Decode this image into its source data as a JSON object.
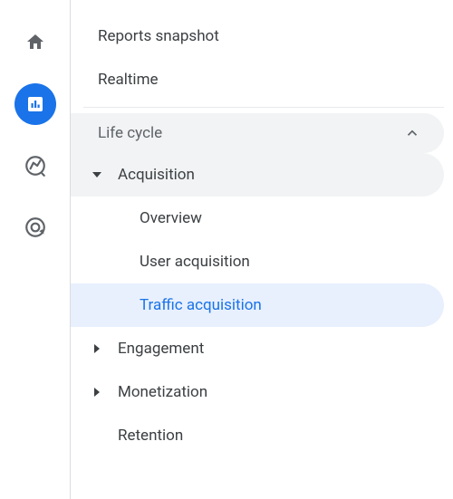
{
  "rail": {
    "items": [
      {
        "name": "home-icon",
        "active": false
      },
      {
        "name": "reports-icon",
        "active": true
      },
      {
        "name": "explore-icon",
        "active": false
      },
      {
        "name": "advertising-icon",
        "active": false
      }
    ]
  },
  "nav": {
    "top": [
      {
        "label": "Reports snapshot"
      },
      {
        "label": "Realtime"
      }
    ],
    "section": {
      "label": "Life cycle",
      "expanded": true
    },
    "groups": [
      {
        "label": "Acquisition",
        "expanded": true,
        "items": [
          {
            "label": "Overview",
            "selected": false
          },
          {
            "label": "User acquisition",
            "selected": false
          },
          {
            "label": "Traffic acquisition",
            "selected": true
          }
        ]
      },
      {
        "label": "Engagement",
        "expanded": false,
        "items": []
      },
      {
        "label": "Monetization",
        "expanded": false,
        "items": []
      },
      {
        "label": "Retention",
        "expanded": false,
        "leaf": true,
        "items": []
      }
    ]
  },
  "colors": {
    "accent": "#1a73e8",
    "selected_bg": "#e8f0fe",
    "section_bg": "#f1f3f4"
  }
}
